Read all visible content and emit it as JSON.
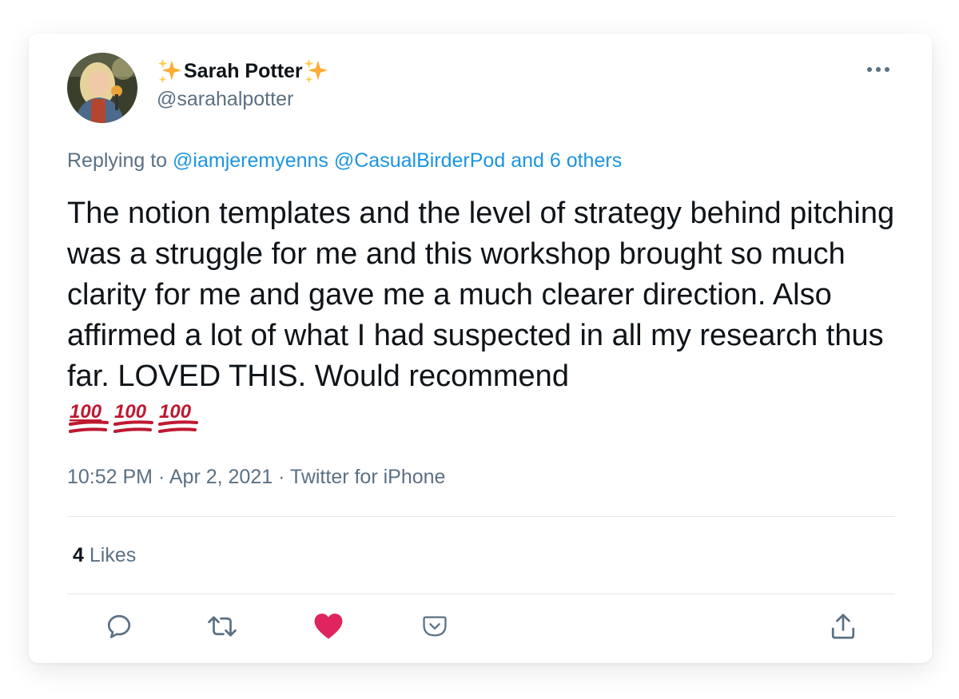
{
  "tweet": {
    "display_name": "Sarah Potter",
    "handle": "@sarahalpotter",
    "replying_prefix": "Replying to",
    "mentions": [
      "@iamjeremyenns",
      "@CasualBirderPod"
    ],
    "and_others": "and 6 others",
    "text": "The notion templates and the level of strategy behind pitching was a struggle for me and this workshop brought so much clarity for me and gave me a much clearer direction. Also affirmed a lot of what I had suspected in all my research thus far. LOVED THIS. Would recommend",
    "emoji": "100",
    "time": "10:52 PM",
    "date": "Apr 2, 2021",
    "source": "Twitter for iPhone",
    "separator": "·",
    "likes_count": "4",
    "likes_label": "Likes"
  },
  "icons": [
    "sparkles-icon",
    "more-icon",
    "reply-icon",
    "retweet-icon",
    "heart-icon",
    "pocket-icon",
    "share-icon"
  ],
  "colors": {
    "text": "#0f1419",
    "secondary": "#5b7083",
    "link": "#1b95e0",
    "like": "#e0245e",
    "emoji_red": "#be1931"
  }
}
